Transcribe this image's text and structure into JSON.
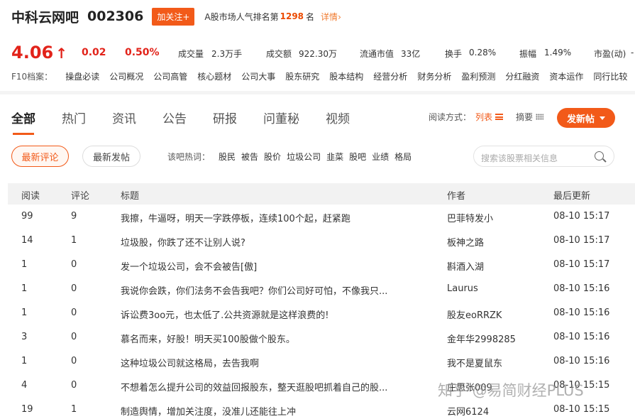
{
  "header": {
    "bar_name": "中科云网吧",
    "stock_code": "002306",
    "follow_label": "加关注+",
    "rank_text": "A股市场人气排名第",
    "rank_num": "1298",
    "rank_unit": "名",
    "detail_link": "详情",
    "price": "4.06",
    "change": "0.02",
    "change_pct": "0.50%",
    "stats": [
      {
        "label": "成交量",
        "value": "2.3万手"
      },
      {
        "label": "成交额",
        "value": "922.30万"
      },
      {
        "label": "流通市值",
        "value": "33亿"
      },
      {
        "label": "换手",
        "value": "0.28%"
      },
      {
        "label": "振幅",
        "value": "1.49%"
      },
      {
        "label": "市盈(动)",
        "value": "-"
      }
    ],
    "f10_label": "F10档案：",
    "f10_items": [
      "操盘必读",
      "公司概况",
      "公司高管",
      "核心题材",
      "公司大事",
      "股东研究",
      "股本结构",
      "经营分析",
      "财务分析",
      "盈利预测",
      "分红融资",
      "资本运作",
      "同行比较"
    ]
  },
  "tabs": [
    "全部",
    "热门",
    "资讯",
    "公告",
    "研报",
    "问董秘",
    "视频"
  ],
  "read_mode": {
    "label": "阅读方式：",
    "list": "列表",
    "summary": "摘要"
  },
  "new_post_label": "发新帖",
  "filters": {
    "latest_comment": "最新评论",
    "latest_post": "最新发帖"
  },
  "hot_words": {
    "label": "该吧热词：",
    "items": [
      "股民",
      "被告",
      "股价",
      "垃圾公司",
      "韭菜",
      "股吧",
      "业绩",
      "格局"
    ]
  },
  "search": {
    "placeholder": "搜索该股票相关信息"
  },
  "table": {
    "columns": [
      "阅读",
      "评论",
      "标题",
      "作者",
      "最后更新"
    ],
    "rows": [
      {
        "read": "99",
        "comment": "9",
        "title": "我擦，牛逼呀，明天一字跌停板，连续100个起，赶紧跑",
        "author": "巴菲特发小",
        "time": "08-10 15:17"
      },
      {
        "read": "14",
        "comment": "1",
        "title": "垃圾股，你跌了还不让别人说?",
        "author": "板神之路",
        "time": "08-10 15:17"
      },
      {
        "read": "1",
        "comment": "0",
        "title": "发一个垃圾公司，会不会被告[傲]",
        "author": "斟酒入湖",
        "time": "08-10 15:17"
      },
      {
        "read": "1",
        "comment": "0",
        "title": "我说你会跌，你们法务不会告我吧？你们公司好可怕，不像我只...",
        "author": "Laurus",
        "time": "08-10 15:16"
      },
      {
        "read": "1",
        "comment": "0",
        "title": "诉讼费3oo元，也太低了.公共资源就是这样浪费的!",
        "author": "股友eoRRZK",
        "time": "08-10 15:16"
      },
      {
        "read": "3",
        "comment": "0",
        "title": "慕名而来，好股！明天买100股做个股东。",
        "author": "金年华2998285",
        "time": "08-10 15:16"
      },
      {
        "read": "1",
        "comment": "0",
        "title": "这种垃圾公司就这格局，去告我啊",
        "author": "我不是夏鼠东",
        "time": "08-10 15:16"
      },
      {
        "read": "4",
        "comment": "0",
        "title": "不想着怎么提升公司的效益回报股东，整天逛股吧抓着自己的股...",
        "author": "庄思张009",
        "time": "08-10 15:15"
      },
      {
        "read": "19",
        "comment": "1",
        "title": "制造舆情，增加关注度，没准儿还能往上冲",
        "author": "云网6124",
        "time": "08-10 15:15"
      }
    ]
  },
  "watermark": "知乎 @易简财经PLUS"
}
